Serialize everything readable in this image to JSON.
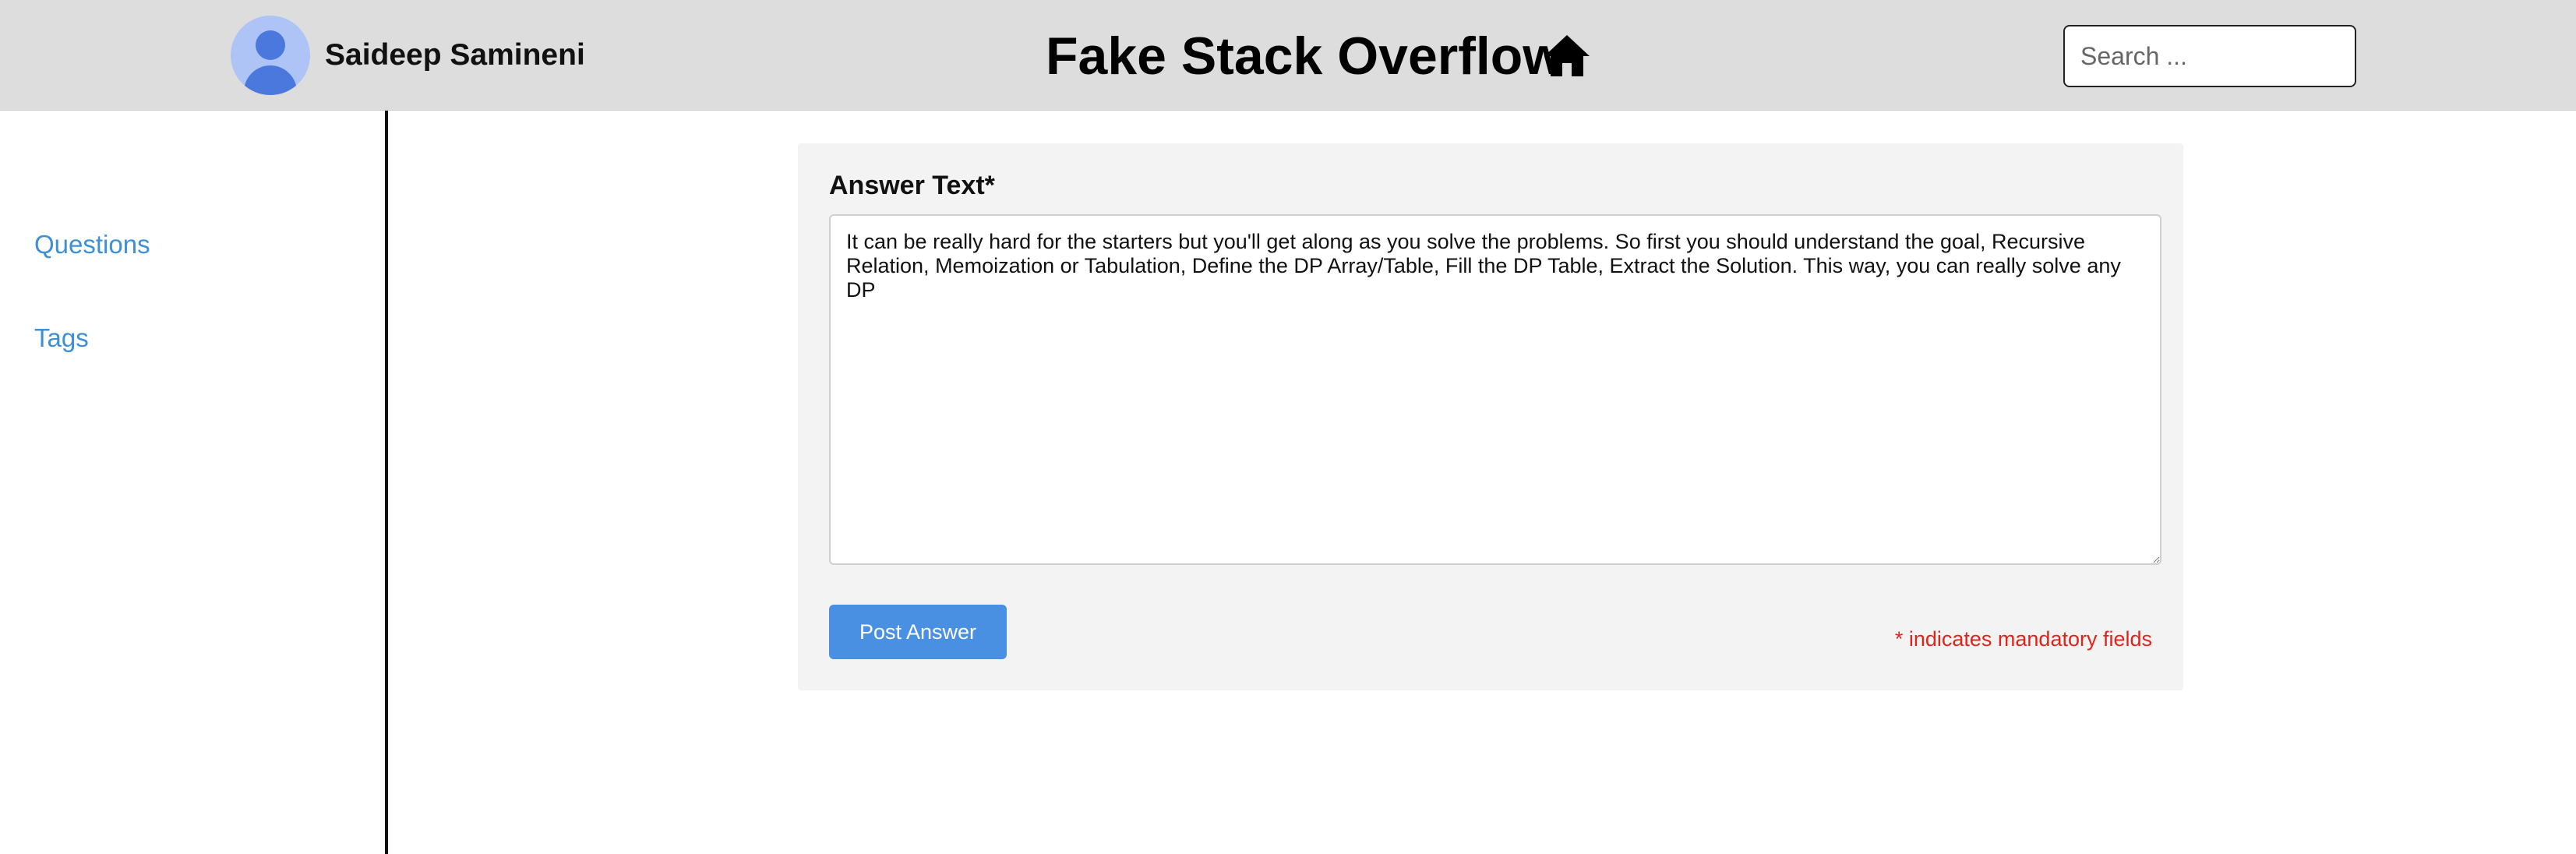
{
  "header": {
    "username": "Saideep Samineni",
    "site_title": "Fake Stack Overflow",
    "search": {
      "placeholder": "Search ...",
      "value": ""
    }
  },
  "sidebar": {
    "items": [
      {
        "label": "Questions"
      },
      {
        "label": "Tags"
      }
    ]
  },
  "answer_form": {
    "label": "Answer Text*",
    "answer_text": "It can be really hard for the starters but you'll get along as you solve the problems. So first you should understand the goal, Recursive Relation, Memoization or Tabulation, Define the DP Array/Table, Fill the DP Table, Extract the Solution. This way, you can really solve any DP",
    "post_button_label": "Post Answer",
    "mandatory_note": "* indicates mandatory fields"
  },
  "icons": {
    "avatar": "user-avatar-icon",
    "home": "home-icon"
  },
  "colors": {
    "header_bg": "#dddddd",
    "link": "#3d8fd6",
    "primary_button": "#4a90e2",
    "error_text": "#e0241b",
    "panel_bg": "#f3f3f3"
  }
}
